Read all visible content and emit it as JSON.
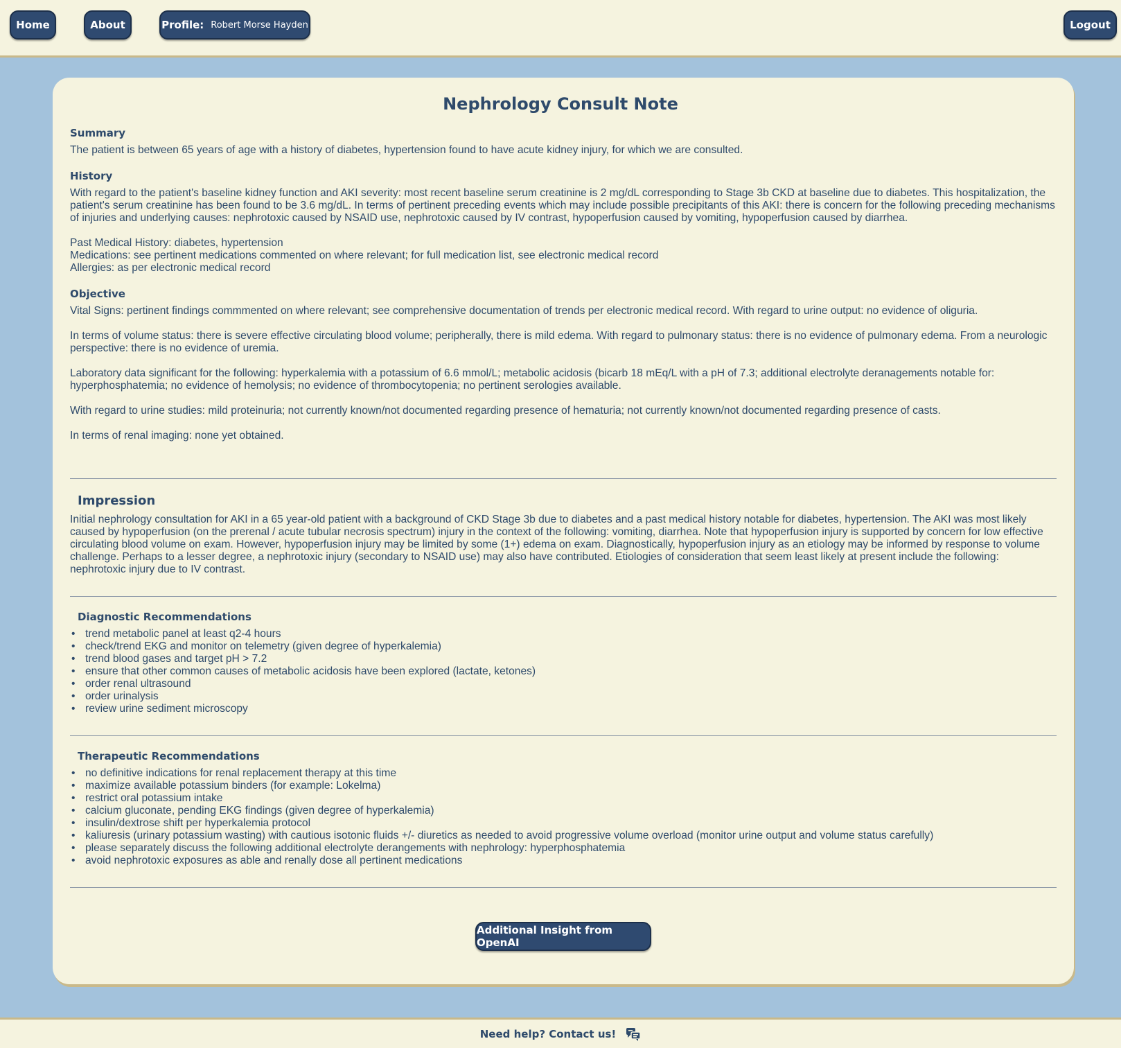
{
  "nav": {
    "home_label": "Home",
    "about_label": "About",
    "profile_label": "Profile:",
    "profile_name": "Robert Morse Hayden",
    "logout_label": "Logout"
  },
  "note": {
    "title": "Nephrology Consult Note",
    "summary_heading": "Summary",
    "summary_text": "The patient is between 65 years of age with a history of diabetes, hypertension found to have acute kidney injury, for which we are consulted.",
    "history_heading": "History",
    "history_text": "With regard to the patient's baseline kidney function and AKI severity: most recent baseline serum creatinine is 2 mg/dL corresponding to Stage 3b CKD at baseline due to diabetes. This hospitalization, the patient's serum creatinine has been found to be 3.6 mg/dL. In terms of pertinent preceding events which may include possible precipitants of this AKI: there is concern for the following preceding mechanisms of injuries and underlying causes: nephrotoxic caused by NSAID use, nephrotoxic caused by IV contrast, hypoperfusion caused by vomiting, hypoperfusion caused by diarrhea.",
    "pmh_text": "Past Medical History: diabetes, hypertension",
    "medications_text": "Medications: see pertinent medications commented on where relevant; for full medication list, see electronic medical record",
    "allergies_text": "Allergies: as per electronic medical record",
    "objective_heading": "Objective",
    "vitals_text": "Vital Signs: pertinent findings commmented on where relevant; see comprehensive documentation of trends per electronic medical record. With regard to urine output: no evidence of oliguria.",
    "volume_text": "In terms of volume status: there is severe effective circulating blood volume; peripherally, there is mild edema. With regard to pulmonary status: there is no evidence of pulmonary edema. From a neurologic perspective: there is no evidence of uremia.",
    "labs_text": "Laboratory data significant for the following: hyperkalemia with a potassium of 6.6 mmol/L; metabolic acidosis (bicarb 18 mEq/L with a pH of 7.3; additional electrolyte deranagements notable for: hyperphosphatemia; no evidence of hemolysis; no evidence of thrombocytopenia; no pertinent serologies available.",
    "urine_text": "With regard to urine studies: mild proteinuria; not currently known/not documented regarding presence of hematuria; not currently known/not documented regarding presence of casts.",
    "imaging_text": "In terms of renal imaging: none yet obtained.",
    "impression_heading": "Impression",
    "impression_text": "Initial nephrology consultation for AKI in a 65 year-old patient with a background of CKD Stage 3b due to diabetes and a past medical history notable for diabetes, hypertension. The AKI was most likely caused by hypoperfusion (on the prerenal / acute tubular necrosis spectrum) injury in the context of the following: vomiting, diarrhea. Note that hypoperfusion injury is supported by concern for low effective circulating blood volume on exam. However, hypoperfusion injury may be limited by some (1+) edema on exam. Diagnostically, hypoperfusion injury as an etiology may be informed by response to volume challenge. Perhaps to a lesser degree, a nephrotoxic injury (secondary to NSAID use) may also have contributed. Etiologies of consideration that seem least likely at present include the following: nephrotoxic injury due to IV contrast.",
    "diagnostic_heading": "Diagnostic Recommendations",
    "diagnostic_items": [
      "trend metabolic panel at least q2-4 hours",
      "check/trend EKG and monitor on telemetry (given degree of hyperkalemia)",
      "trend blood gases and target pH > 7.2",
      "ensure that other common causes of metabolic acidosis have been explored (lactate, ketones)",
      "order renal ultrasound",
      "order urinalysis",
      "review urine sediment microscopy"
    ],
    "therapeutic_heading": "Therapeutic Recommendations",
    "therapeutic_items": [
      "no definitive indications for renal replacement therapy at this time",
      "maximize available potassium binders (for example: Lokelma)",
      "restrict oral potassium intake",
      "calcium gluconate, pending EKG findings (given degree of hyperkalemia)",
      "insulin/dextrose shift per hyperkalemia protocol",
      "kaliuresis (urinary potassium wasting) with cautious isotonic fluids +/- diuretics as needed to avoid progressive volume overload (monitor urine output and volume status carefully)",
      "please separately discuss the following additional electrolyte derangements with nephrology: hyperphosphatemia",
      "avoid nephrotoxic exposures as able and renally dose all pertinent medications"
    ],
    "insight_button_label": "Additional Insight from OpenAI"
  },
  "footer": {
    "help_text": "Need help? Contact us!",
    "icon": "contact-support-icon"
  },
  "colors": {
    "page_background": "#a3c2dc",
    "panel_background": "#f5f3df",
    "button_background": "#2f4a70",
    "text": "#2e4a6b",
    "border_accent": "#c9b98a"
  }
}
